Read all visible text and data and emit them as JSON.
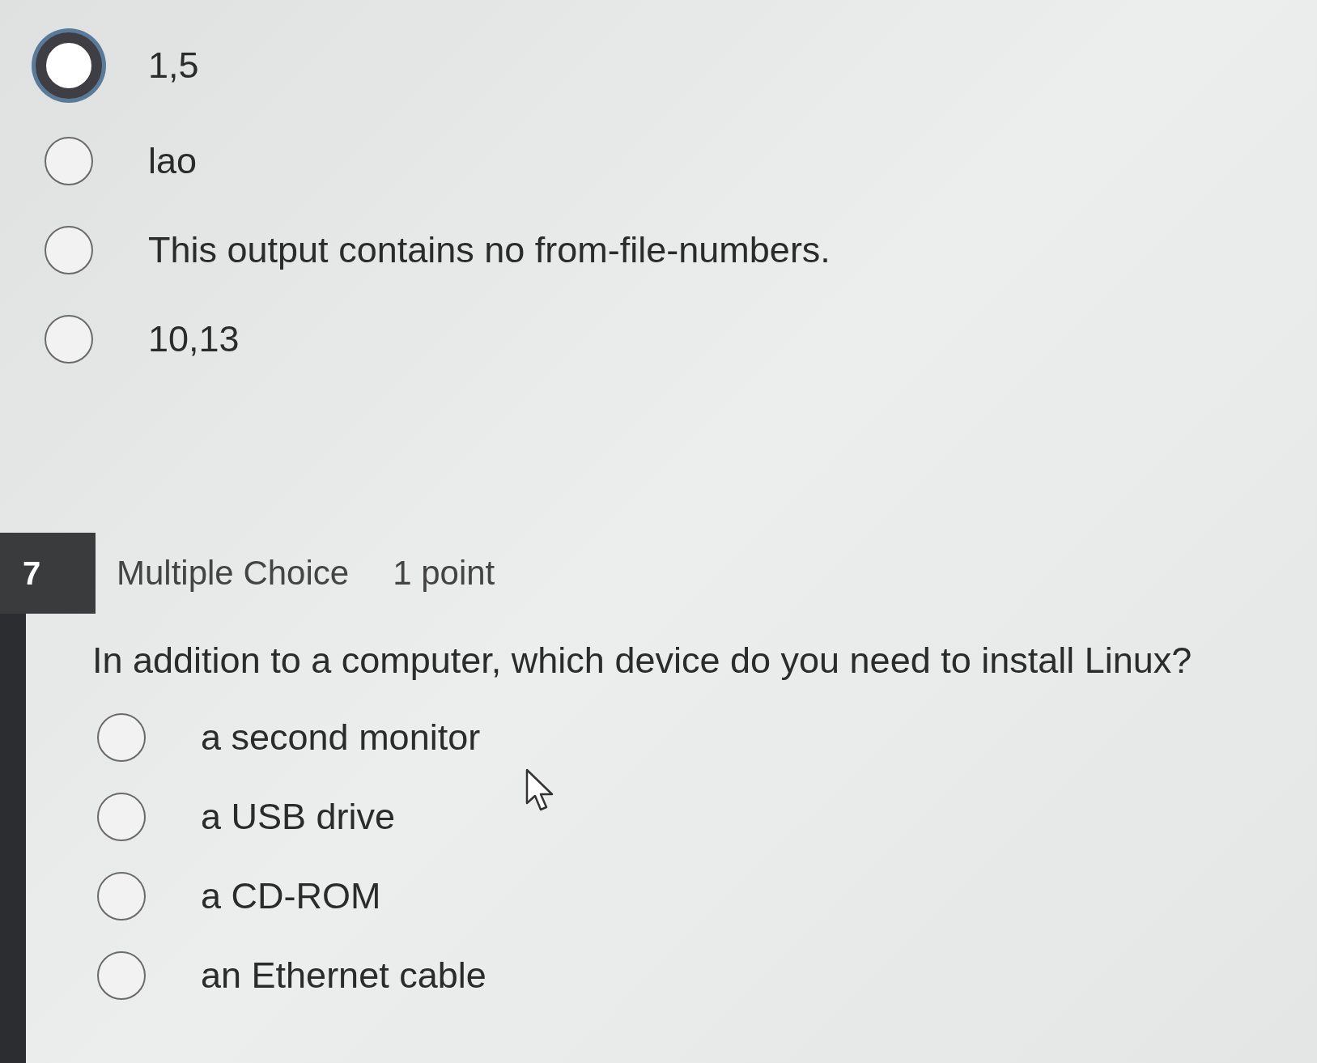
{
  "previous_question": {
    "options": [
      {
        "label": "1,5",
        "selected": true
      },
      {
        "label": "lao",
        "selected": false
      },
      {
        "label": "This output contains no from-file-numbers.",
        "selected": false
      },
      {
        "label": "10,13",
        "selected": false
      }
    ]
  },
  "question": {
    "number": "7",
    "type": "Multiple Choice",
    "points": "1 point",
    "text": "In addition to a computer, which device do you need to install Linux?",
    "options": [
      {
        "label": "a second monitor",
        "selected": false
      },
      {
        "label": "a USB drive",
        "selected": false
      },
      {
        "label": "a CD-ROM",
        "selected": false
      },
      {
        "label": "an Ethernet cable",
        "selected": false
      }
    ]
  }
}
